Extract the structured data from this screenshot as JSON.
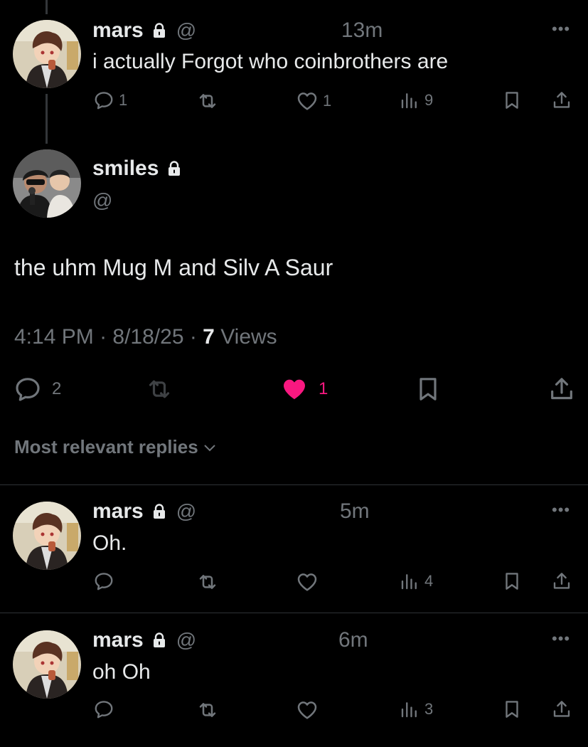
{
  "colors": {
    "background": "#000000",
    "text": "#e7e9ea",
    "muted": "#71767b",
    "like": "#f91880",
    "divider": "#2f3336"
  },
  "parent": {
    "name": "mars",
    "handle": "@",
    "time": "13m",
    "text": "i actually Forgot who coinbrothers are",
    "replies": "1",
    "likes": "1",
    "views": "9"
  },
  "main": {
    "name": "smiles",
    "handle": "@",
    "text": "the uhm Mug M and Silv A Saur",
    "time": "4:14 PM",
    "date": "8/18/25",
    "views_count": "7",
    "views_label": "Views",
    "replies": "2",
    "likes": "1"
  },
  "sort_label": "Most relevant replies",
  "replies": [
    {
      "name": "mars",
      "handle": "@",
      "time": "5m",
      "text": "Oh.",
      "views": "4"
    },
    {
      "name": "mars",
      "handle": "@",
      "time": "6m",
      "text": "oh Oh",
      "views": "3"
    }
  ],
  "icons": [
    "lock-icon",
    "reply-icon",
    "retweet-icon",
    "like-icon",
    "views-icon",
    "bookmark-icon",
    "share-icon",
    "more-icon",
    "chevron-down-icon"
  ]
}
